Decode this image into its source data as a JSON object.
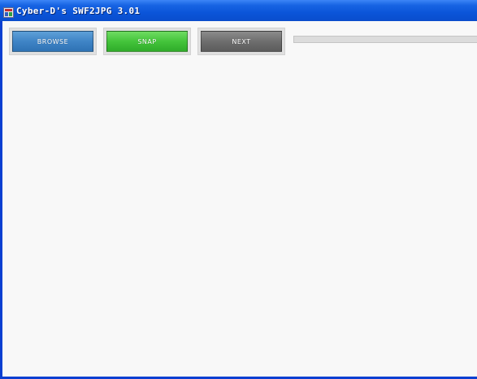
{
  "window": {
    "title": "Cyber-D's SWF2JPG 3.01"
  },
  "toolbar": {
    "browse_label": "BROWSE",
    "snap_label": "SNAP",
    "next_label": "NEXT"
  },
  "progress": {
    "value_percent": 0
  },
  "colors": {
    "titlebar": "#0b55d9",
    "browse": "#3f84c6",
    "snap": "#44c43b",
    "next": "#6e6e6e",
    "background": "#f8f8f8"
  }
}
